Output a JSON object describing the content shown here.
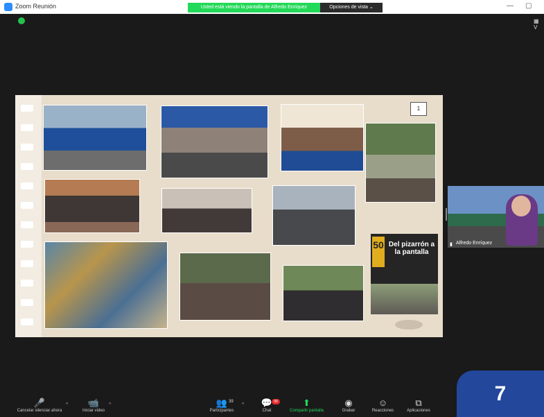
{
  "titlebar": {
    "app_title": "Zoom Reunión",
    "minimize": "—",
    "maximize": "▢"
  },
  "share": {
    "banner_text": "Usted está viendo la pantalla de Alfredo Enríquez",
    "view_options_label": "Opciones de vista ⌄"
  },
  "top_right": {
    "view_label": "▦ V"
  },
  "slide": {
    "poster_badge": "50",
    "poster_title": "Del pizarrón a la pantalla",
    "page_box": "1"
  },
  "video": {
    "participant_name": "Alfredo Enríquez"
  },
  "toolbar": {
    "mute_label": "Cancelar silenciar ahora",
    "video_label": "Iniciar video",
    "participants_count": "39",
    "participants_label": "Participantes",
    "chat_label": "Chat",
    "chat_badge": "99",
    "share_label": "Compartir pantalla",
    "record_label": "Grabar",
    "reactions_label": "Reacciones",
    "apps_label": "Aplicaciones"
  },
  "page_counter": "7",
  "colors": {
    "share_green": "#23d959",
    "counter_blue": "#23479b",
    "chat_red": "#e02828"
  }
}
